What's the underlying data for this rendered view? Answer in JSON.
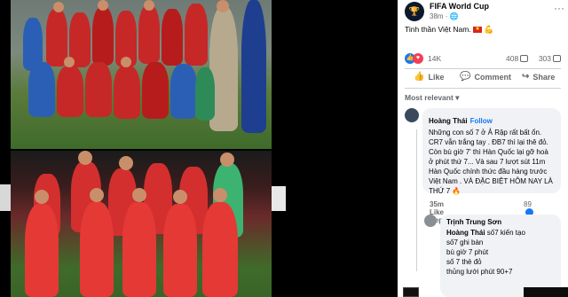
{
  "post": {
    "page_name": "FIFA World Cup",
    "time": "38m",
    "caption_text": "Tinh thần Việt Nam.",
    "reactions_count": "14K",
    "comments_count": "408",
    "shares_count": "303"
  },
  "actions": {
    "like": "Like",
    "comment": "Comment",
    "share": "Share"
  },
  "comments_sort": "Most relevant",
  "comments": [
    {
      "author": "Hoàng Thái",
      "follow": "Follow",
      "text": "Những con số 7 ở Ả Rập rất bất ổn. CR7 vẫn trắng tay . ĐB7 thì lại thê đỏ. Còn bù giờ 7' thì Hàn Quốc lại gỡ hoà ở phút thứ 7... Và sau 7 lượt sút 11m Hàn Quốc chính thức đầu hàng trước Việt Nam . VÀ ĐẶC BIỆT HÔM NAY LÀ THỨ 7",
      "time": "35m",
      "like": "Like",
      "reply": "Reply",
      "react_count": "89"
    },
    {
      "author": "Trịnh Trung Sơn",
      "mention": "Hoàng Thái",
      "text_first": " số7 kiến tạo",
      "lines": [
        "số7 ghi bàn",
        "bù giờ 7 phút",
        "số 7 thẻ đỏ",
        "thủng lưới phút 90+7"
      ]
    }
  ],
  "photo": {
    "board_text": "CO"
  },
  "colors": {
    "fb_blue": "#1877f2",
    "vn_red": "#da251d",
    "pitch_green": "#3f6b2a"
  },
  "icons": {
    "page_avatar": "fifa-trophy-icon",
    "more": "ellipsis-icon",
    "like": "thumbs-up-icon",
    "comment": "speech-bubble-icon",
    "share": "share-arrow-icon"
  }
}
